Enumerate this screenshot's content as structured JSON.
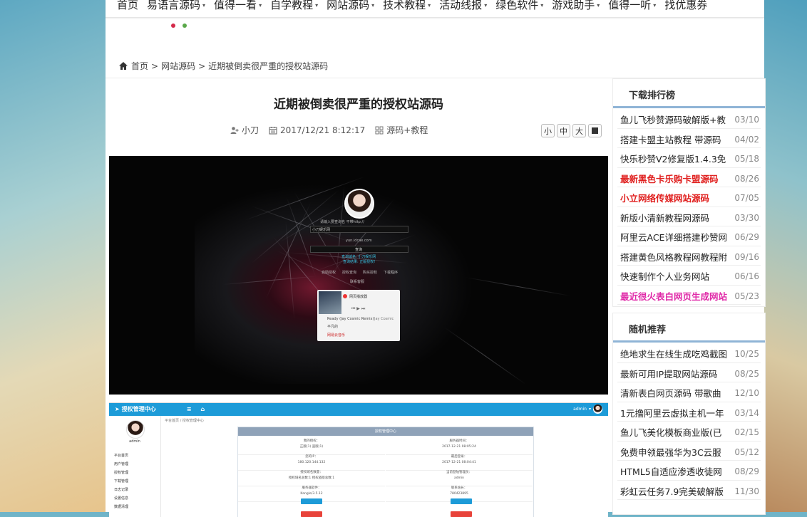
{
  "nav": {
    "items": [
      {
        "label": "首页",
        "has_arrow": false
      },
      {
        "label": "易语言源码",
        "has_arrow": true
      },
      {
        "label": "值得一看",
        "has_arrow": true
      },
      {
        "label": "自学教程",
        "has_arrow": true
      },
      {
        "label": "网站源码",
        "has_arrow": true
      },
      {
        "label": "技术教程",
        "has_arrow": true
      },
      {
        "label": "活动线报",
        "has_arrow": true
      },
      {
        "label": "绿色软件",
        "has_arrow": true
      },
      {
        "label": "游戏助手",
        "has_arrow": true
      },
      {
        "label": "值得一听",
        "has_arrow": true
      },
      {
        "label": "找优惠券",
        "has_arrow": false
      }
    ],
    "arrow_glyph": "▾",
    "dot_colors": [
      "#d42a4a",
      "#5aa84a"
    ]
  },
  "breadcrumb": {
    "home": "首页",
    "sep": ">",
    "category": "网站源码",
    "current": "近期被倒卖很严重的授权站源码"
  },
  "article": {
    "title": "近期被倒卖很严重的授权站源码",
    "author": "小刀",
    "datetime": "2017/12/21 8:12:17",
    "category": "源码+教程",
    "size_buttons": [
      "小",
      "中",
      "大"
    ]
  },
  "shot1": {
    "prompt": "请输入要查询名 不带http://",
    "input_value": "小刀娱乐网",
    "domain_text": "yun.idcae.com",
    "query_button": "查询",
    "result_line1": "查询域名: 小刀娱乐网",
    "result_line2": "查询结果: 正版授权!",
    "links": [
      "自助授权",
      "授权查询",
      "购买授权",
      "下载程序"
    ],
    "contact": "联系客服",
    "player_title": "网页播放器",
    "track": "Ready (Jay Cosmic Remix)",
    "artist": "Jay Cosmic",
    "track2": "平凡的",
    "brand": "网易云音乐"
  },
  "shot2": {
    "title": "授权管理中心",
    "user": "admin",
    "username": "admin",
    "menu": [
      "平台首页",
      "用户管理",
      "授权管理",
      "下载管理",
      "日志记录",
      "设置信息",
      "数据清理"
    ],
    "crumb": "平台首页 / 授权管理中心",
    "panel_title": "授权管理中心",
    "cells": [
      {
        "label": "我的授权：",
        "value": "正版(1) 盗版(1)"
      },
      {
        "label": "服务器时间：",
        "value": "2017-12-21 08:05:24"
      },
      {
        "label": "您的IP：",
        "value": "180.120.144.132"
      },
      {
        "label": "最后登录：",
        "value": "2017-12-21 08:04:41"
      },
      {
        "label": "授权域名数量：",
        "value": "授权域名总数:1 授权盗版总数:1"
      },
      {
        "label": "当前登陆管理员：",
        "value": "admin"
      },
      {
        "label": "服务器软件：",
        "value": "Kangle/3.5.12"
      },
      {
        "label": "联系站长：",
        "value": "780423895"
      }
    ],
    "btn_colors": [
      "#1d9bd8",
      "#e8433a"
    ]
  },
  "sidebar": {
    "download_title": "下载排行榜",
    "download_items": [
      {
        "title": "鱼儿飞秒赞源码破解版+教",
        "date": "03/10",
        "style": "normal"
      },
      {
        "title": "搭建卡盟主站教程 带源码",
        "date": "04/02",
        "style": "normal"
      },
      {
        "title": "快乐秒赞V2修复版1.4.3免",
        "date": "05/18",
        "style": "normal"
      },
      {
        "title": "最新黑色卡乐购卡盟源码",
        "date": "08/26",
        "style": "red"
      },
      {
        "title": "小立网络传媒网站源码",
        "date": "07/05",
        "style": "red"
      },
      {
        "title": "新版小清新教程网源码",
        "date": "03/30",
        "style": "normal"
      },
      {
        "title": "阿里云ACE详细搭建秒赞网",
        "date": "06/29",
        "style": "normal"
      },
      {
        "title": "搭建黄色风格教程网教程附",
        "date": "09/16",
        "style": "normal"
      },
      {
        "title": "快速制作个人业务网站",
        "date": "06/16",
        "style": "normal"
      },
      {
        "title": "最近很火表白网页生成网站",
        "date": "05/23",
        "style": "magenta"
      }
    ],
    "random_title": "随机推荐",
    "random_items": [
      {
        "title": "绝地求生在线生成吃鸡截图",
        "date": "10/25"
      },
      {
        "title": "最新可用IP提取网站源码",
        "date": "08/25"
      },
      {
        "title": "清新表白网页源码 带歌曲",
        "date": "12/10"
      },
      {
        "title": "1元撸阿里云虚拟主机一年",
        "date": "03/14"
      },
      {
        "title": "鱼儿飞美化模板商业版(已",
        "date": "02/15"
      },
      {
        "title": "免费申领最强华为3C云服",
        "date": "05/12"
      },
      {
        "title": "HTML5自适应渗透收徒网",
        "date": "08/29"
      },
      {
        "title": "彩虹云任务7.9完美破解版",
        "date": "11/30"
      }
    ],
    "accent_color": "#8fb4d6"
  }
}
